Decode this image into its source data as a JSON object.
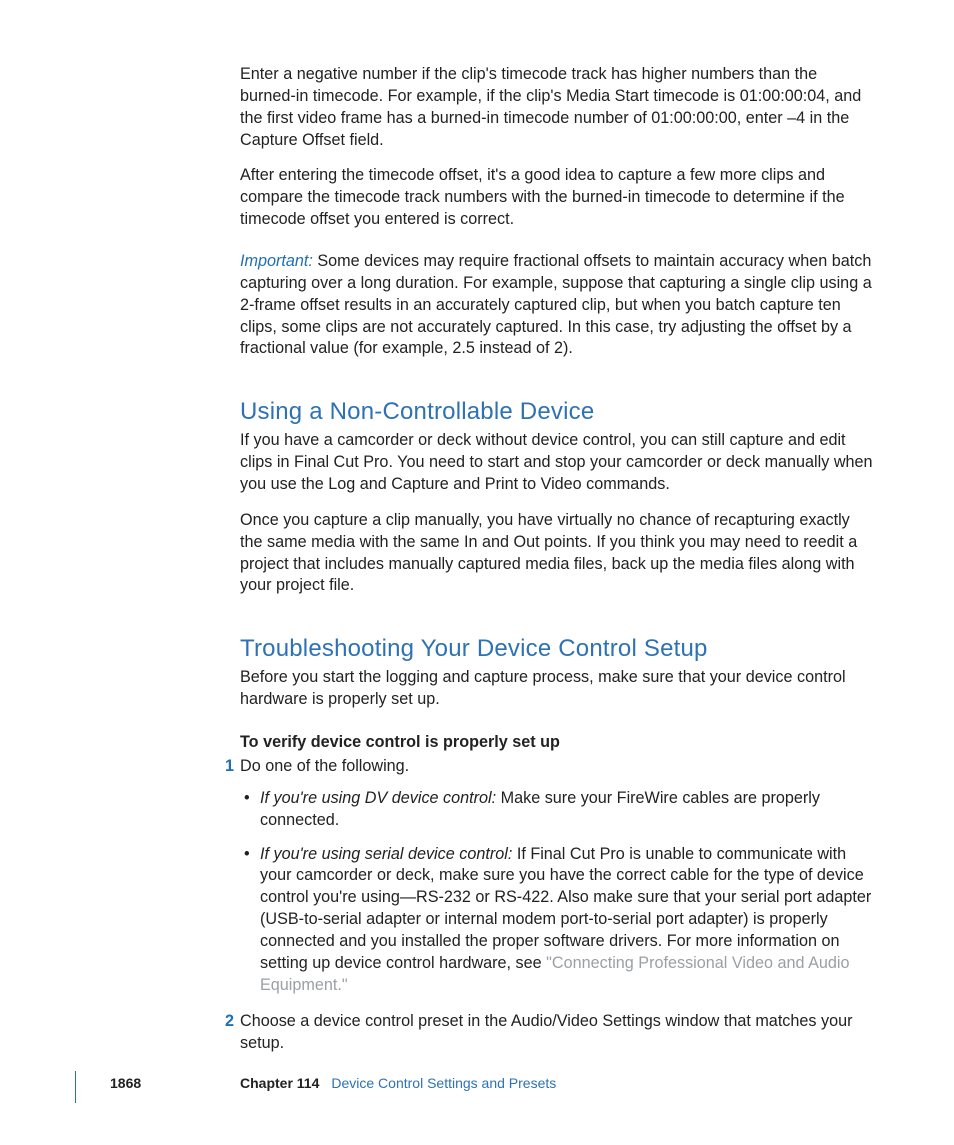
{
  "para1": "Enter a negative number if the clip's timecode track has higher numbers than the burned-in timecode. For example, if the clip's Media Start timecode is 01:00:00:04, and the first video frame has a burned-in timecode number of 01:00:00:00, enter –4 in the Capture Offset field.",
  "para2": "After entering the timecode offset, it's a good idea to capture a few more clips and compare the timecode track numbers with the burned-in timecode to determine if the timecode offset you entered is correct.",
  "important_label": "Important:  ",
  "important_body": "Some devices may require fractional offsets to maintain accuracy when batch capturing over a long duration. For example, suppose that capturing a single clip using a 2-frame offset results in an accurately captured clip, but when you batch capture ten clips, some clips are not accurately captured. In this case, try adjusting the offset by a fractional value (for example, 2.5 instead of 2).",
  "h2a": "Using a Non-Controllable Device",
  "h2a_p1": "If you have a camcorder or deck without device control, you can still capture and edit clips in Final Cut Pro. You need to start and stop your camcorder or deck manually when you use the Log and Capture and Print to Video commands.",
  "h2a_p2": "Once you capture a clip manually, you have virtually no chance of recapturing exactly the same media with the same In and Out points. If you think you may need to reedit a project that includes manually captured media files, back up the media files along with your project file.",
  "h2b": "Troubleshooting Your Device Control Setup",
  "h2b_p1": "Before you start the logging and capture process, make sure that your device control hardware is properly set up.",
  "bold_lead": "To verify device control is properly set up",
  "step1_num": "1",
  "step1_text": "Do one of the following.",
  "bullet1_lead": "If you're using DV device control:   ",
  "bullet1_body": "Make sure your FireWire cables are properly connected.",
  "bullet2_lead": "If you're using serial device control:   ",
  "bullet2_body_a": "If Final Cut Pro is unable to communicate with your camcorder or deck, make sure you have the correct cable for the type of device control you're using—RS-232 or RS-422. Also make sure that your serial port adapter (USB-to-serial adapter or internal modem port-to-serial port adapter) is properly connected and you installed the proper software drivers. For more information on setting up device control hardware, see ",
  "bullet2_link": "\"Connecting Professional Video and Audio Equipment.\"",
  "step2_num": "2",
  "step2_text": "Choose a device control preset in the Audio/Video Settings window that matches your setup.",
  "footer": {
    "page": "1868",
    "chapter_label": "Chapter 114",
    "chapter_title": "Device Control Settings and Presets"
  }
}
